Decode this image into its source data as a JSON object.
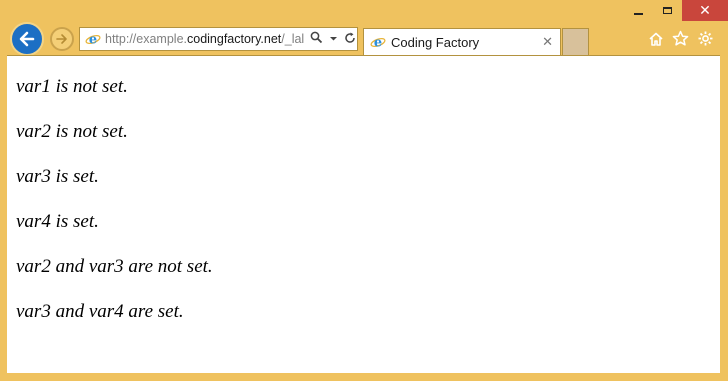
{
  "window": {
    "controls": {
      "minimize": "minimize",
      "maximize": "maximize",
      "close": "✕"
    }
  },
  "nav": {
    "back_icon": "back-arrow-icon",
    "forward_icon": "forward-arrow-icon"
  },
  "address": {
    "prefix": "http://example.",
    "domain": "codingfactory.net",
    "suffix": "/_lal",
    "search_icon": "search-icon",
    "dropdown_icon": "dropdown-icon",
    "refresh_icon": "refresh-icon"
  },
  "tab": {
    "title": "Coding Factory",
    "close": "✕"
  },
  "toolbar": {
    "home_icon": "home-icon",
    "favorites_icon": "star-icon",
    "tools_icon": "gear-icon"
  },
  "page": {
    "lines": [
      "var1 is not set.",
      "var2 is not set.",
      "var3 is set.",
      "var4 is set.",
      "var2 and var3 are not set.",
      "var3 and var4 are set."
    ]
  },
  "colors": {
    "frame": "#efc25f",
    "back_button": "#1c6fc4",
    "close_button": "#c9463c"
  }
}
